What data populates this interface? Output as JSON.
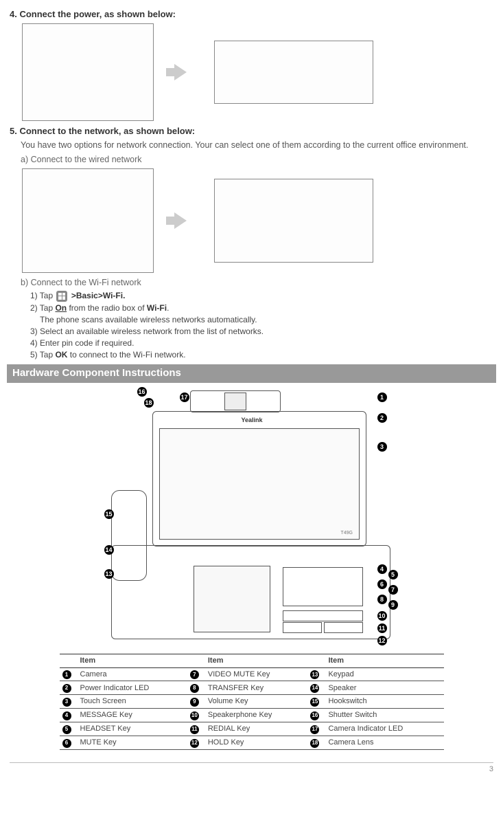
{
  "step4": {
    "title": "4. Connect the power, as shown below:"
  },
  "step5": {
    "title": "5. Connect to the network, as shown below:",
    "desc": "You have two options for network connection. Your can select one of them according to the current office environment.",
    "opt_a": "a) Connect to the wired network",
    "opt_b": "b) Connect to the Wi-Fi network",
    "wifi": {
      "s1_pre": "1) Tap",
      "s1_post": ">Basic>Wi-Fi.",
      "s2a": "2) Tap ",
      "s2_on": "On",
      "s2b": " from the radio box of ",
      "s2_wifi": "Wi-Fi",
      "s2c": ".",
      "s2_line2": "The phone scans available wireless networks automatically.",
      "s3": "3) Select an available wireless network from the list of networks.",
      "s4": "4) Enter pin code if required.",
      "s5a": "5) Tap ",
      "s5_ok": "OK",
      "s5b": " to connect to the Wi-Fi network."
    }
  },
  "hw_section": "Hardware Component Instructions",
  "table": {
    "header": "Item",
    "rows": [
      {
        "n": "1",
        "a": "Camera",
        "n2": "7",
        "b": "VIDEO MUTE Key",
        "n3": "13",
        "c": "Keypad"
      },
      {
        "n": "2",
        "a": "Power Indicator LED",
        "n2": "8",
        "b": "TRANSFER Key",
        "n3": "14",
        "c": "Speaker"
      },
      {
        "n": "3",
        "a": "Touch Screen",
        "n2": "9",
        "b": "Volume Key",
        "n3": "15",
        "c": "Hookswitch"
      },
      {
        "n": "4",
        "a": "MESSAGE Key",
        "n2": "10",
        "b": "Speakerphone Key",
        "n3": "16",
        "c": "Shutter Switch"
      },
      {
        "n": "5",
        "a": "HEADSET Key",
        "n2": "11",
        "b": "REDIAL Key",
        "n3": "17",
        "c": "Camera Indicator LED"
      },
      {
        "n": "6",
        "a": "MUTE Key",
        "n2": "12",
        "b": "HOLD Key",
        "n3": "18",
        "c": "Camera Lens"
      }
    ]
  },
  "callouts": [
    "1",
    "2",
    "3",
    "4",
    "5",
    "6",
    "7",
    "8",
    "9",
    "10",
    "11",
    "12",
    "13",
    "14",
    "15",
    "16",
    "17",
    "18"
  ],
  "page": "3",
  "brand": "Yealink",
  "model": "T49G"
}
